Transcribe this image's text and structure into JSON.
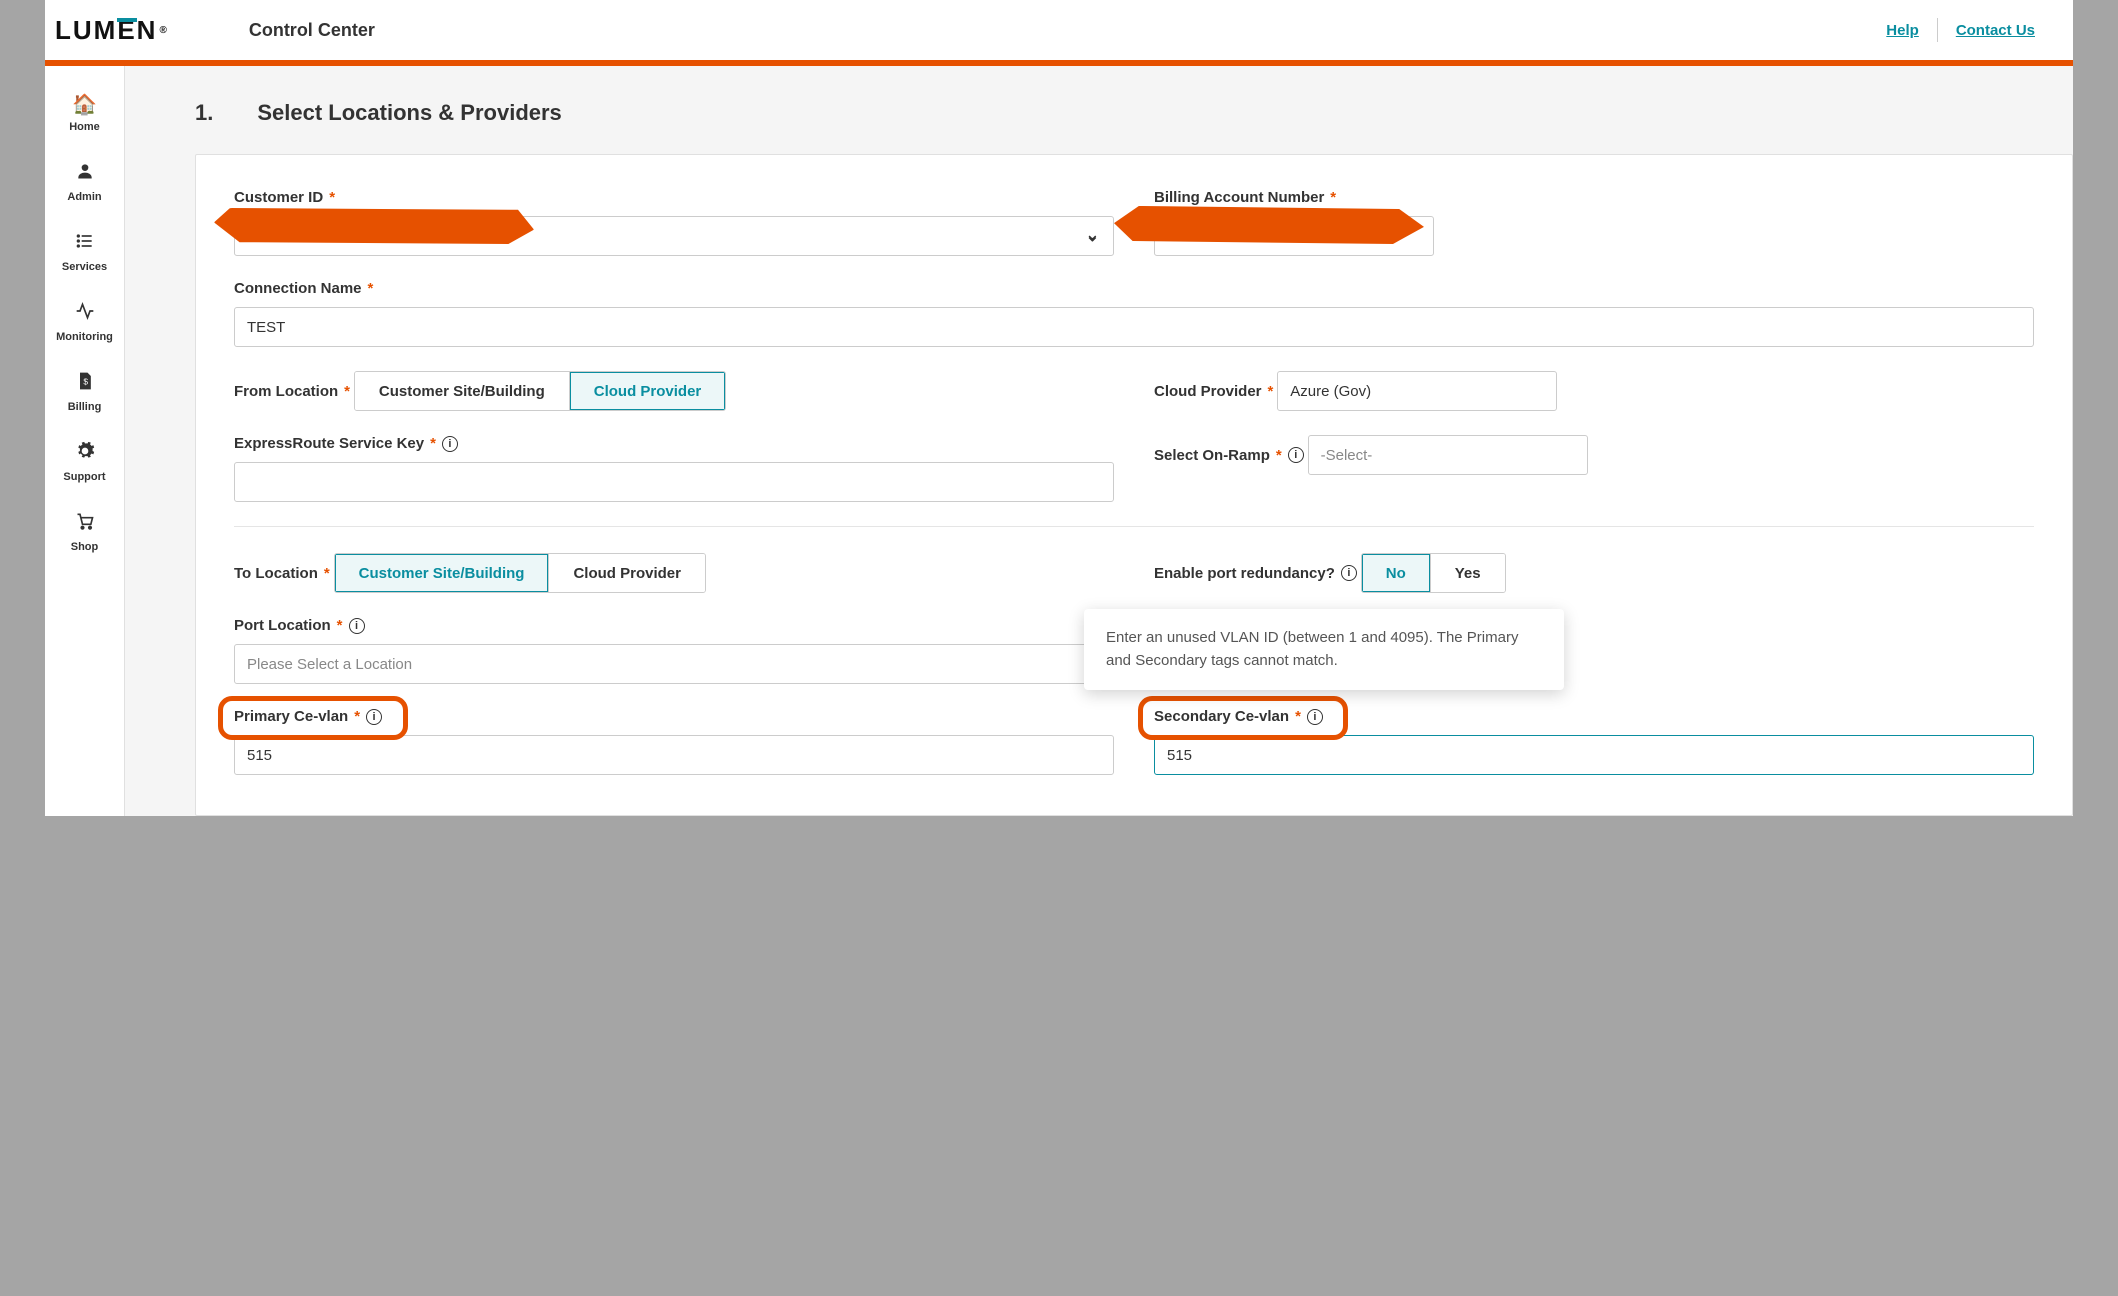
{
  "header": {
    "logo_text": "LUMEN",
    "app_title": "Control Center",
    "help_link": "Help",
    "contact_link": "Contact Us"
  },
  "sidebar": {
    "items": [
      {
        "label": "Home",
        "icon": "home"
      },
      {
        "label": "Admin",
        "icon": "user"
      },
      {
        "label": "Services",
        "icon": "list"
      },
      {
        "label": "Monitoring",
        "icon": "activity"
      },
      {
        "label": "Billing",
        "icon": "invoice"
      },
      {
        "label": "Support",
        "icon": "gear"
      },
      {
        "label": "Shop",
        "icon": "cart"
      }
    ]
  },
  "step": {
    "number": "1.",
    "title": "Select Locations & Providers"
  },
  "form": {
    "customer_id_label": "Customer ID",
    "billing_account_label": "Billing Account Number",
    "connection_name_label": "Connection Name",
    "connection_name_value": "TEST",
    "from_location_label": "From Location",
    "from_location_options": {
      "site": "Customer Site/Building",
      "cloud": "Cloud Provider"
    },
    "cloud_provider_label": "Cloud Provider",
    "cloud_provider_value": "Azure (Gov)",
    "expressroute_label": "ExpressRoute Service Key",
    "expressroute_value": "",
    "onramp_label": "Select On-Ramp",
    "onramp_placeholder": "-Select-",
    "to_location_label": "To Location",
    "to_location_options": {
      "site": "Customer Site/Building",
      "cloud": "Cloud Provider"
    },
    "redundancy_label": "Enable port redundancy?",
    "redundancy_options": {
      "no": "No",
      "yes": "Yes"
    },
    "port_location_label": "Port Location",
    "port_location_placeholder": "Please Select a Location",
    "primary_cevlan_label": "Primary Ce-vlan",
    "primary_cevlan_value": "515",
    "secondary_cevlan_label": "Secondary Ce-vlan",
    "secondary_cevlan_value": "515",
    "tooltip_text": "Enter an unused VLAN ID (between 1 and 4095). The Primary and Secondary tags cannot match."
  }
}
